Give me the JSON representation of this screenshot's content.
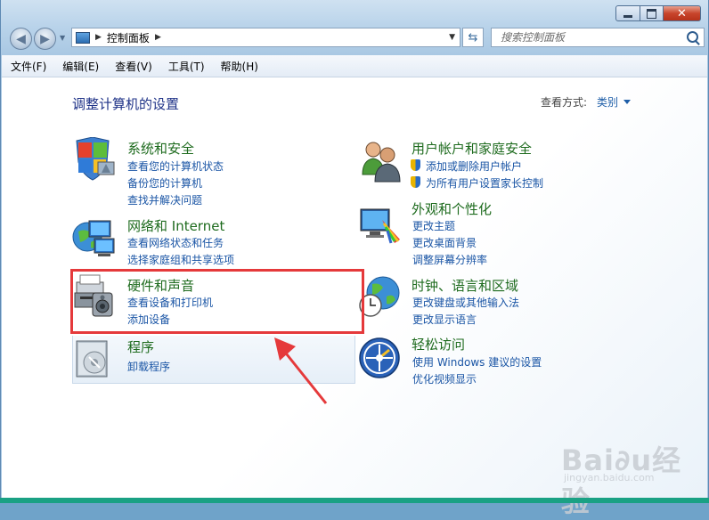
{
  "window": {
    "address": {
      "crumb": "控制面板"
    },
    "search": {
      "placeholder": "搜索控制面板"
    },
    "caption": {
      "close": "✕"
    }
  },
  "menu": [
    "文件(F)",
    "编辑(E)",
    "查看(V)",
    "工具(T)",
    "帮助(H)"
  ],
  "page": {
    "title": "调整计算机的设置",
    "view_by_label": "查看方式:",
    "view_by_value": "类别"
  },
  "left_categories": [
    {
      "title": "系统和安全",
      "links": [
        "查看您的计算机状态",
        "备份您的计算机",
        "查找并解决问题"
      ],
      "icon": "system-security-icon"
    },
    {
      "title": "网络和 Internet",
      "links": [
        "查看网络状态和任务",
        "选择家庭组和共享选项"
      ],
      "icon": "network-icon"
    },
    {
      "title": "硬件和声音",
      "links": [
        "查看设备和打印机",
        "添加设备"
      ],
      "icon": "hardware-sound-icon",
      "highlighted": true
    },
    {
      "title": "程序",
      "links": [
        "卸载程序"
      ],
      "icon": "programs-icon"
    }
  ],
  "right_categories": [
    {
      "title": "用户帐户和家庭安全",
      "links": [
        "添加或删除用户帐户",
        "为所有用户设置家长控制"
      ],
      "icon": "user-accounts-icon",
      "shield_links": true
    },
    {
      "title": "外观和个性化",
      "links": [
        "更改主题",
        "更改桌面背景",
        "调整屏幕分辨率"
      ],
      "icon": "appearance-icon"
    },
    {
      "title": "时钟、语言和区域",
      "links": [
        "更改键盘或其他输入法",
        "更改显示语言"
      ],
      "icon": "clock-region-icon"
    },
    {
      "title": "轻松访问",
      "links": [
        "使用 Windows 建议的设置",
        "优化视频显示"
      ],
      "icon": "ease-of-access-icon"
    }
  ],
  "watermark": {
    "brand": "Bai∂u经验",
    "url": "jingyan.baidu.com"
  },
  "colors": {
    "category_title": "#1e6b1e",
    "link": "#1a55a5",
    "page_title": "#1e3287",
    "highlight_box": "#e5393b"
  }
}
